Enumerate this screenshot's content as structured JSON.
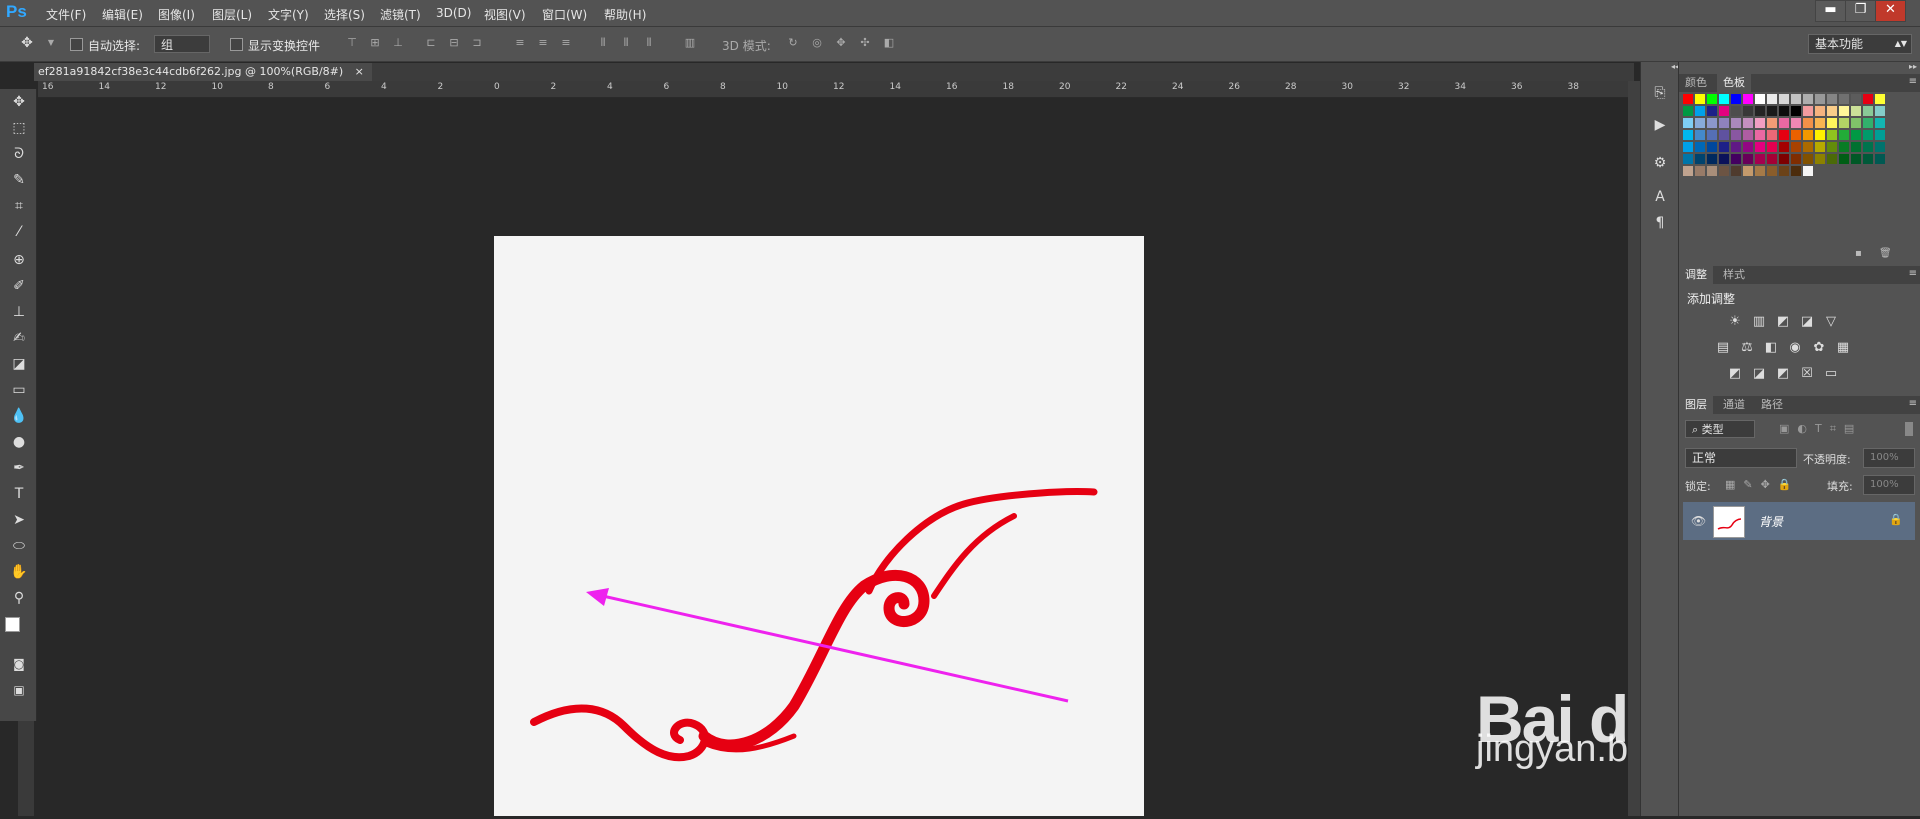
{
  "app": {
    "logo": "Ps",
    "doc_tab_title": "ef281a91842cf38e3c44cdb6f262.jpg @ 100%(RGB/8#)",
    "close_glyph": "×"
  },
  "menu": [
    "文件(F)",
    "编辑(E)",
    "图像(I)",
    "图层(L)",
    "文字(Y)",
    "选择(S)",
    "滤镜(T)",
    "3D(D)",
    "视图(V)",
    "窗口(W)",
    "帮助(H)"
  ],
  "window_controls": {
    "minimize": "▬",
    "restore": "❐",
    "close": "✕"
  },
  "options": {
    "auto_select_label": "自动选择:",
    "auto_select_value": "组",
    "show_transform_label": "显示变换控件",
    "mode_3d_label": "3D 模式:",
    "workspace": "基本功能"
  },
  "ruler_top": [
    "16",
    "14",
    "12",
    "10",
    "8",
    "6",
    "4",
    "2",
    "0",
    "2",
    "4",
    "6",
    "8",
    "10",
    "12",
    "14",
    "16",
    "18",
    "20",
    "22",
    "24",
    "26",
    "28",
    "30",
    "32",
    "34",
    "36",
    "38"
  ],
  "panels": {
    "color_tabs": [
      "颜色",
      "色板"
    ],
    "adjust_tabs": [
      "调整",
      "样式"
    ],
    "adjust_title": "添加调整",
    "layer_tabs": [
      "图层",
      "通道",
      "路径"
    ],
    "filter_kind": "类型",
    "blend_mode": "正常",
    "opacity_label": "不透明度:",
    "opacity_value": "100%",
    "lock_label": "锁定:",
    "fill_label": "填充:",
    "fill_value": "100%",
    "layer_name": "背景"
  },
  "watermark": {
    "brand": "Bai du 经验",
    "url": "jingyan.baidu.com"
  },
  "colors": {
    "accent": "#31a8ff",
    "swirl": "#e60012",
    "arrow": "#ee22ee",
    "layer_highlight": "#5c6d83"
  }
}
